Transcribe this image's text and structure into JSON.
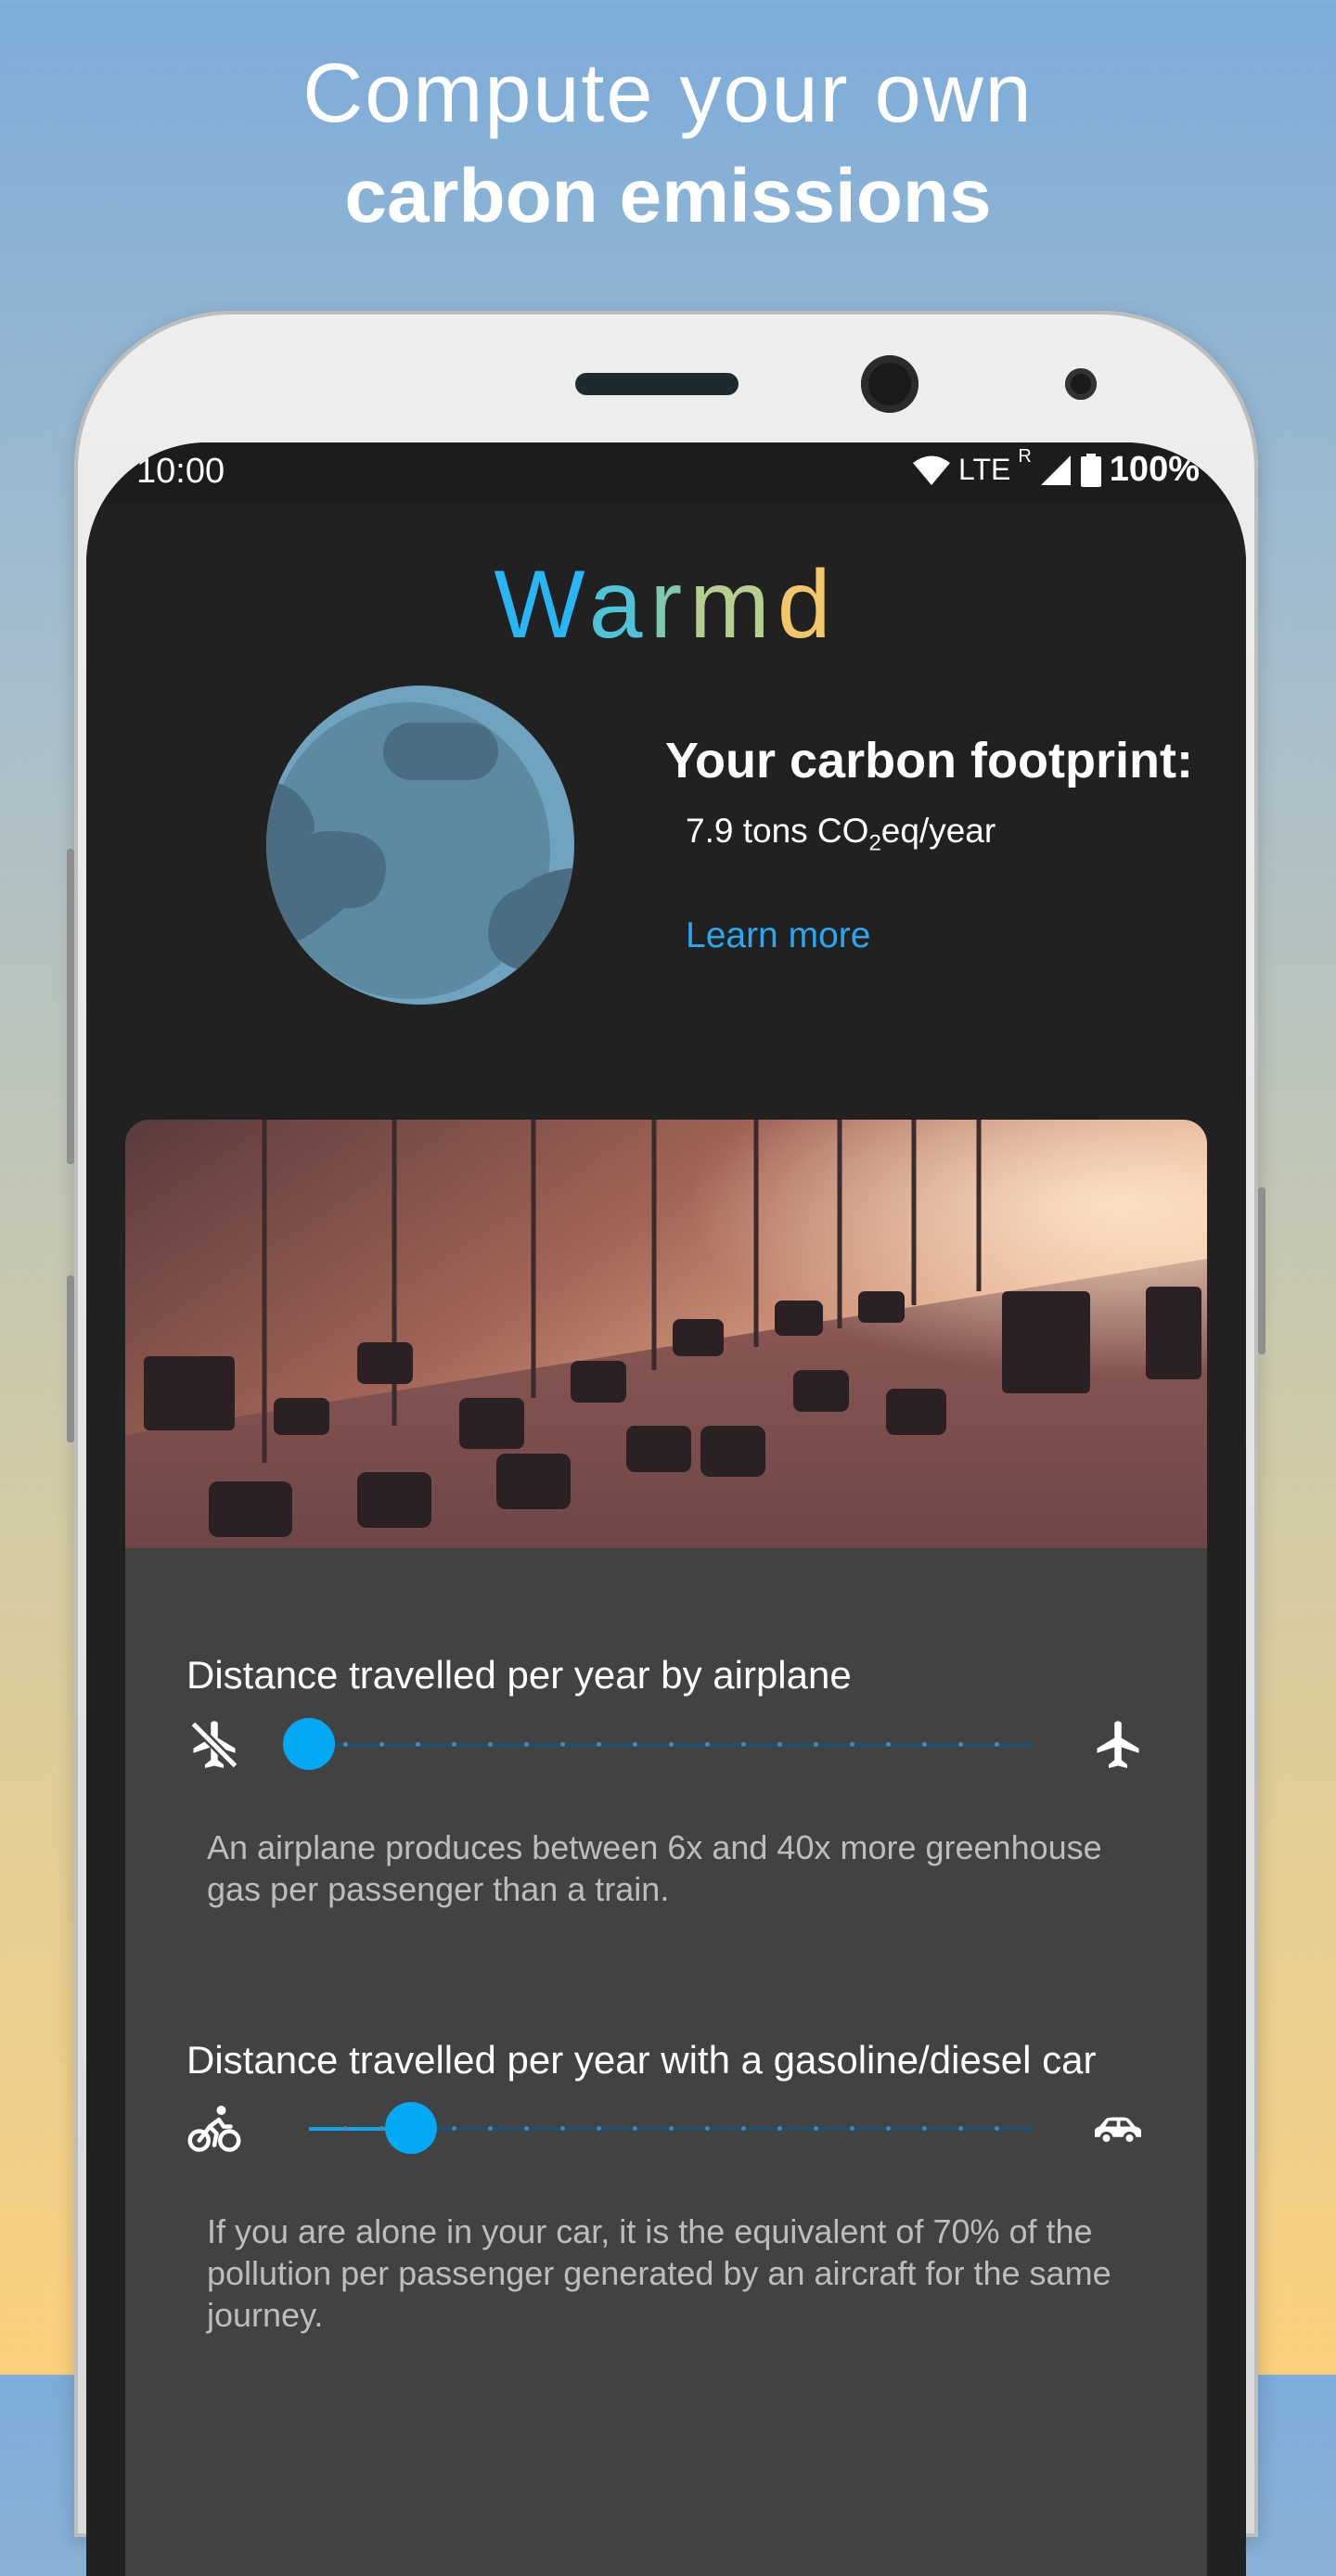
{
  "headline": {
    "line1": "Compute your own",
    "line2": "carbon emissions"
  },
  "status_bar": {
    "time": "10:00",
    "network": "LTE",
    "roaming": "R",
    "battery": "100%"
  },
  "app": {
    "logo_letters": [
      "W",
      "a",
      "r",
      "m",
      "d"
    ]
  },
  "footprint": {
    "title": "Your carbon footprint:",
    "value_prefix": "7.9 tons CO",
    "value_sub": "2",
    "value_suffix": "eq/year",
    "link": "Learn more"
  },
  "sections": [
    {
      "label": "Distance travelled per year by airplane",
      "description": "An airplane produces between 6x and 40x more greenhouse gas per passenger than a train.",
      "min_icon": "airplane-off-icon",
      "max_icon": "airplane-icon",
      "value_fraction": 0.0
    },
    {
      "label": "Distance travelled per year with a gasoline/diesel car",
      "description": "If you are alone in your car, it is the equivalent of 70% of the pollution per passenger generated by an aircraft for the same journey.",
      "min_icon": "bicycle-icon",
      "max_icon": "car-icon",
      "value_fraction": 0.09
    }
  ],
  "colors": {
    "accent": "#03a9f4",
    "background": "#212121",
    "card": "#424242",
    "link": "#29a8f0"
  }
}
